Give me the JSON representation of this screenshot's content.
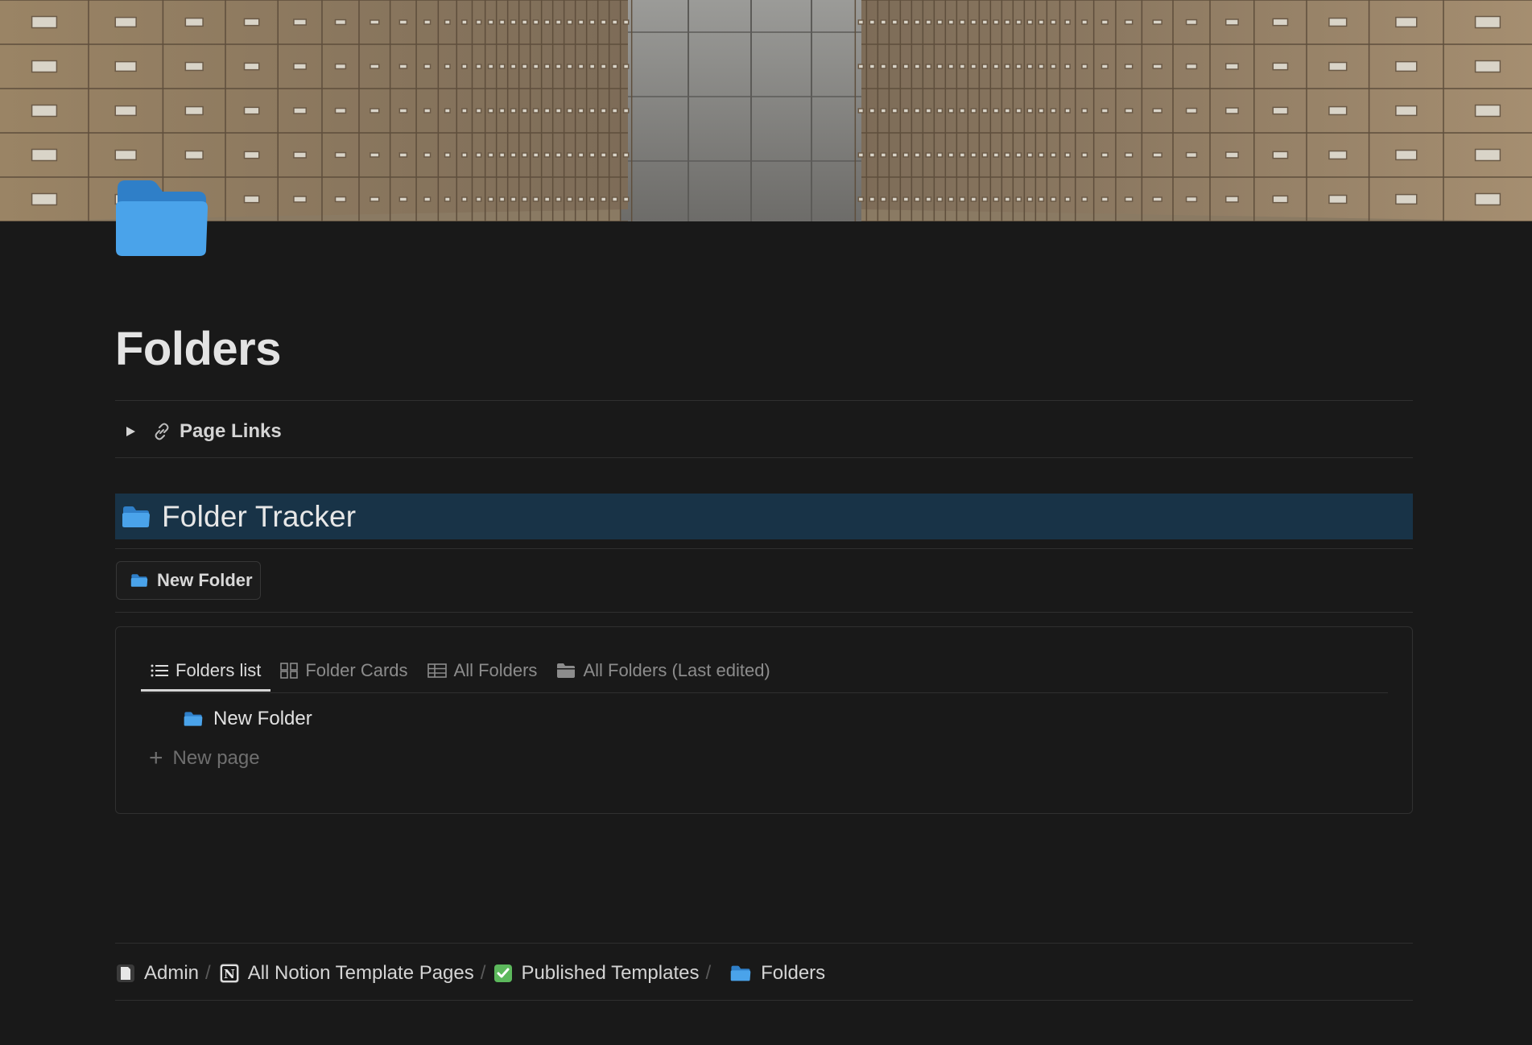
{
  "page": {
    "title": "Folders",
    "icon": "folder-icon"
  },
  "toggle": {
    "label": "Page Links",
    "icon": "link-icon"
  },
  "tracker": {
    "heading": "Folder Tracker",
    "heading_bg": "#183347",
    "button_label": "New Folder"
  },
  "database": {
    "tabs": [
      {
        "label": "Folders list",
        "icon": "list-icon",
        "active": true
      },
      {
        "label": "Folder Cards",
        "icon": "gallery-icon",
        "active": false
      },
      {
        "label": "All Folders",
        "icon": "table-icon",
        "active": false
      },
      {
        "label": "All Folders (Last edited)",
        "icon": "folder-icon",
        "active": false
      }
    ],
    "items": [
      {
        "label": "New Folder",
        "icon": "folder-icon"
      }
    ],
    "new_page_label": "New page"
  },
  "breadcrumbs": [
    {
      "label": "Admin",
      "icon": "page-icon"
    },
    {
      "label": "All Notion Template Pages",
      "icon": "notion-icon"
    },
    {
      "label": "Published Templates",
      "icon": "checkbox-icon"
    },
    {
      "label": "Folders",
      "icon": "folder-icon"
    }
  ],
  "colors": {
    "background": "#191919",
    "folder_blue": "#4aa3ea",
    "check_green": "#5cb85c"
  }
}
